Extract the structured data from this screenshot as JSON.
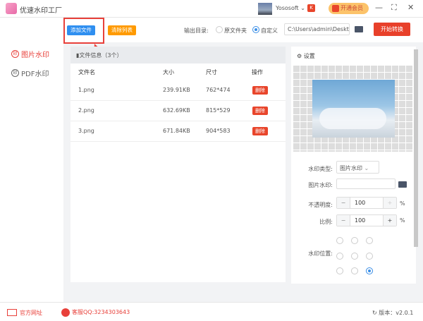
{
  "app": {
    "title": "优速水印工厂",
    "user": "Yososoft",
    "vip_label": "开通会员"
  },
  "sidebar": {
    "items": [
      {
        "label": "图片水印",
        "icon": "印",
        "active": true
      },
      {
        "label": "PDF水印",
        "icon": "印",
        "active": false
      }
    ]
  },
  "toolbar": {
    "add_file": "添加文件",
    "clear_list": "清除列表",
    "output_label": "输出目录:",
    "option_original": "原文件夹",
    "option_custom": "自定义",
    "output_path": "C:\\Users\\admin\\Deskto",
    "start": "开始转换"
  },
  "files": {
    "header": "文件信息（3个）",
    "columns": [
      "文件名",
      "大小",
      "尺寸",
      "操作"
    ],
    "rows": [
      {
        "name": "1.png",
        "size": "239.91KB",
        "dim": "762*474",
        "action": "删除"
      },
      {
        "name": "2.png",
        "size": "632.69KB",
        "dim": "815*529",
        "action": "删除"
      },
      {
        "name": "3.png",
        "size": "671.84KB",
        "dim": "904*583",
        "action": "删除"
      }
    ]
  },
  "settings": {
    "title": "设置",
    "type_label": "水印类型:",
    "type_value": "图片水印",
    "image_label": "图片水印:",
    "opacity_label": "不透明度:",
    "opacity": "100",
    "scale_label": "比例:",
    "scale": "100",
    "percent": "%",
    "position_label": "水印位置:",
    "position_selected": "bottom-right",
    "minus": "−",
    "plus": "+"
  },
  "footer": {
    "website": "官方网址",
    "qq": "客服QQ:3234303643",
    "version": "版本：v2.0.1"
  },
  "colors": {
    "accent_blue": "#3a8ee6",
    "orange": "#ff9a00",
    "red": "#e8452b"
  }
}
